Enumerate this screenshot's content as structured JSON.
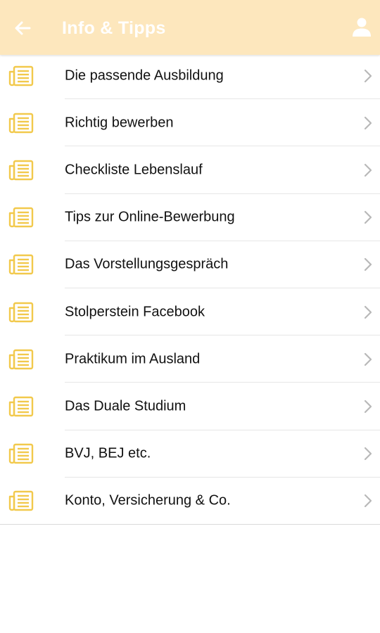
{
  "header": {
    "title": "Info & Tipps",
    "back_icon": "arrow-left-icon",
    "profile_icon": "user-icon",
    "background_color": "#fde7bd"
  },
  "list": {
    "item_icon": "newspaper-icon",
    "icon_color": "#f2c94c",
    "chevron_icon": "chevron-right-icon",
    "items": [
      {
        "label": "Die passende Ausbildung"
      },
      {
        "label": "Richtig bewerben"
      },
      {
        "label": "Checkliste Lebenslauf"
      },
      {
        "label": "Tips zur Online-Bewerbung"
      },
      {
        "label": "Das Vorstellungsgespräch"
      },
      {
        "label": "Stolperstein Facebook"
      },
      {
        "label": "Praktikum im Ausland"
      },
      {
        "label": "Das Duale Studium"
      },
      {
        "label": "BVJ, BEJ etc."
      },
      {
        "label": "Konto, Versicherung & Co."
      }
    ]
  }
}
